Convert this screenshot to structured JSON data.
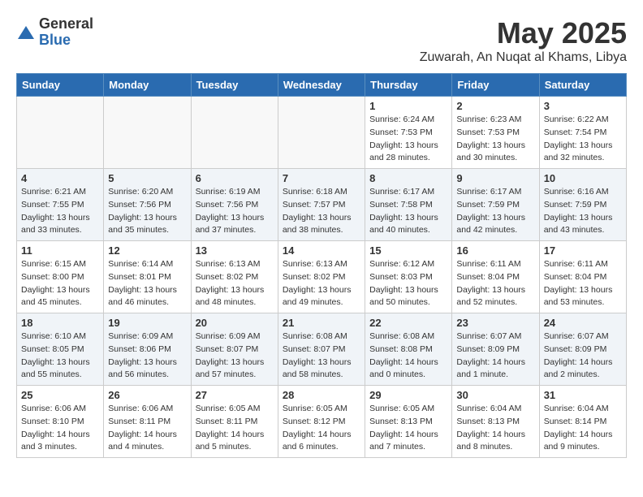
{
  "header": {
    "logo_general": "General",
    "logo_blue": "Blue",
    "title": "May 2025",
    "location": "Zuwarah, An Nuqat al Khams, Libya"
  },
  "weekdays": [
    "Sunday",
    "Monday",
    "Tuesday",
    "Wednesday",
    "Thursday",
    "Friday",
    "Saturday"
  ],
  "weeks": [
    [
      {
        "day": "",
        "info": ""
      },
      {
        "day": "",
        "info": ""
      },
      {
        "day": "",
        "info": ""
      },
      {
        "day": "",
        "info": ""
      },
      {
        "day": "1",
        "info": "Sunrise: 6:24 AM\nSunset: 7:53 PM\nDaylight: 13 hours\nand 28 minutes."
      },
      {
        "day": "2",
        "info": "Sunrise: 6:23 AM\nSunset: 7:53 PM\nDaylight: 13 hours\nand 30 minutes."
      },
      {
        "day": "3",
        "info": "Sunrise: 6:22 AM\nSunset: 7:54 PM\nDaylight: 13 hours\nand 32 minutes."
      }
    ],
    [
      {
        "day": "4",
        "info": "Sunrise: 6:21 AM\nSunset: 7:55 PM\nDaylight: 13 hours\nand 33 minutes."
      },
      {
        "day": "5",
        "info": "Sunrise: 6:20 AM\nSunset: 7:56 PM\nDaylight: 13 hours\nand 35 minutes."
      },
      {
        "day": "6",
        "info": "Sunrise: 6:19 AM\nSunset: 7:56 PM\nDaylight: 13 hours\nand 37 minutes."
      },
      {
        "day": "7",
        "info": "Sunrise: 6:18 AM\nSunset: 7:57 PM\nDaylight: 13 hours\nand 38 minutes."
      },
      {
        "day": "8",
        "info": "Sunrise: 6:17 AM\nSunset: 7:58 PM\nDaylight: 13 hours\nand 40 minutes."
      },
      {
        "day": "9",
        "info": "Sunrise: 6:17 AM\nSunset: 7:59 PM\nDaylight: 13 hours\nand 42 minutes."
      },
      {
        "day": "10",
        "info": "Sunrise: 6:16 AM\nSunset: 7:59 PM\nDaylight: 13 hours\nand 43 minutes."
      }
    ],
    [
      {
        "day": "11",
        "info": "Sunrise: 6:15 AM\nSunset: 8:00 PM\nDaylight: 13 hours\nand 45 minutes."
      },
      {
        "day": "12",
        "info": "Sunrise: 6:14 AM\nSunset: 8:01 PM\nDaylight: 13 hours\nand 46 minutes."
      },
      {
        "day": "13",
        "info": "Sunrise: 6:13 AM\nSunset: 8:02 PM\nDaylight: 13 hours\nand 48 minutes."
      },
      {
        "day": "14",
        "info": "Sunrise: 6:13 AM\nSunset: 8:02 PM\nDaylight: 13 hours\nand 49 minutes."
      },
      {
        "day": "15",
        "info": "Sunrise: 6:12 AM\nSunset: 8:03 PM\nDaylight: 13 hours\nand 50 minutes."
      },
      {
        "day": "16",
        "info": "Sunrise: 6:11 AM\nSunset: 8:04 PM\nDaylight: 13 hours\nand 52 minutes."
      },
      {
        "day": "17",
        "info": "Sunrise: 6:11 AM\nSunset: 8:04 PM\nDaylight: 13 hours\nand 53 minutes."
      }
    ],
    [
      {
        "day": "18",
        "info": "Sunrise: 6:10 AM\nSunset: 8:05 PM\nDaylight: 13 hours\nand 55 minutes."
      },
      {
        "day": "19",
        "info": "Sunrise: 6:09 AM\nSunset: 8:06 PM\nDaylight: 13 hours\nand 56 minutes."
      },
      {
        "day": "20",
        "info": "Sunrise: 6:09 AM\nSunset: 8:07 PM\nDaylight: 13 hours\nand 57 minutes."
      },
      {
        "day": "21",
        "info": "Sunrise: 6:08 AM\nSunset: 8:07 PM\nDaylight: 13 hours\nand 58 minutes."
      },
      {
        "day": "22",
        "info": "Sunrise: 6:08 AM\nSunset: 8:08 PM\nDaylight: 14 hours\nand 0 minutes."
      },
      {
        "day": "23",
        "info": "Sunrise: 6:07 AM\nSunset: 8:09 PM\nDaylight: 14 hours\nand 1 minute."
      },
      {
        "day": "24",
        "info": "Sunrise: 6:07 AM\nSunset: 8:09 PM\nDaylight: 14 hours\nand 2 minutes."
      }
    ],
    [
      {
        "day": "25",
        "info": "Sunrise: 6:06 AM\nSunset: 8:10 PM\nDaylight: 14 hours\nand 3 minutes."
      },
      {
        "day": "26",
        "info": "Sunrise: 6:06 AM\nSunset: 8:11 PM\nDaylight: 14 hours\nand 4 minutes."
      },
      {
        "day": "27",
        "info": "Sunrise: 6:05 AM\nSunset: 8:11 PM\nDaylight: 14 hours\nand 5 minutes."
      },
      {
        "day": "28",
        "info": "Sunrise: 6:05 AM\nSunset: 8:12 PM\nDaylight: 14 hours\nand 6 minutes."
      },
      {
        "day": "29",
        "info": "Sunrise: 6:05 AM\nSunset: 8:13 PM\nDaylight: 14 hours\nand 7 minutes."
      },
      {
        "day": "30",
        "info": "Sunrise: 6:04 AM\nSunset: 8:13 PM\nDaylight: 14 hours\nand 8 minutes."
      },
      {
        "day": "31",
        "info": "Sunrise: 6:04 AM\nSunset: 8:14 PM\nDaylight: 14 hours\nand 9 minutes."
      }
    ]
  ]
}
